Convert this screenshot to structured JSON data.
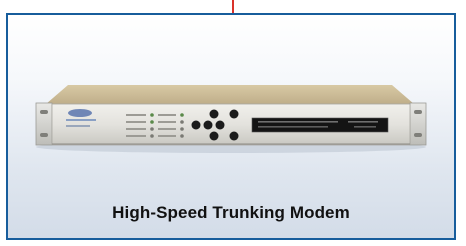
{
  "card": {
    "caption": "High-Speed Trunking Modem",
    "border_color": "#175d9c",
    "accent_tick_color": "#d9322a"
  },
  "device": {
    "image_subject": "rack-mount modem unit",
    "icons": [
      "keypad-icon",
      "display-window-icon",
      "rack-ear-icon"
    ]
  }
}
